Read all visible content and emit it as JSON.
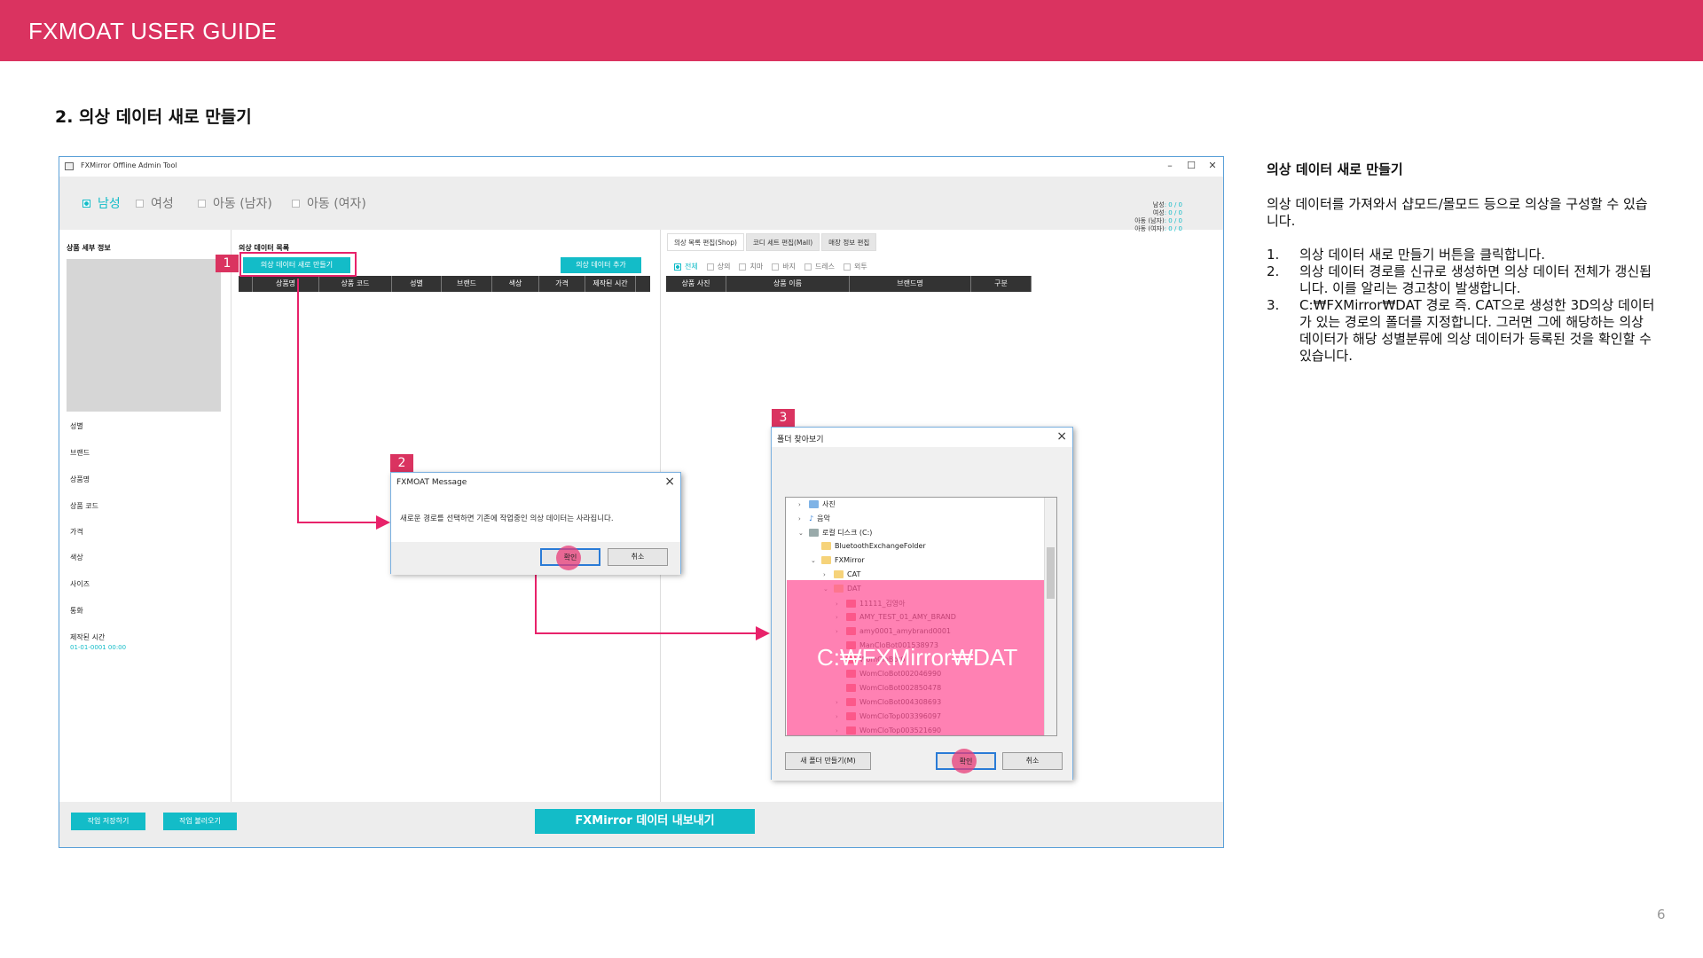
{
  "header": {
    "title": "FXMOAT USER GUIDE"
  },
  "section_title": "2. 의상 데이터 새로 만들기",
  "page_number": "6",
  "description": {
    "heading": "의상 데이터 새로 만들기",
    "intro": "의상 데이터를 가져와서 샵모드/몰모드 등으로 의상을 구성할 수 있습니다.",
    "steps": [
      {
        "num": "1.",
        "text": "의상 데이터 새로 만들기 버튼을 클릭합니다."
      },
      {
        "num": "2.",
        "text": "의상 데이터 경로를 신규로 생성하면 의상 데이터 전체가 갱신됩니다. 이를 알리는 경고창이 발생합니다."
      },
      {
        "num": "3.",
        "text": "C:₩FXMirror₩DAT 경로 즉. CAT으로 생성한 3D의상 데이터가 있는 경로의 폴더를 지정합니다. 그러면 그에 해당하는 의상 데이터가 해당 성별분류에 의상 데이터가 등록된 것을 확인할 수 있습니다."
      }
    ]
  },
  "app": {
    "window_title": "FXMirror Offline Admin Tool",
    "controls": {
      "minimize": "–",
      "maximize": "☐",
      "close": "✕"
    },
    "gender_options": [
      {
        "label": "남성",
        "selected": true
      },
      {
        "label": "여성",
        "selected": false
      },
      {
        "label": "아동 (남자)",
        "selected": false
      },
      {
        "label": "아동 (여자)",
        "selected": false
      }
    ],
    "counts": [
      {
        "label": "남성",
        "value": ": 0 / 0"
      },
      {
        "label": "여성",
        "value": ": 0 / 0"
      },
      {
        "label": "아동 (남자)",
        "value": ": 0 / 0"
      },
      {
        "label": "아동 (여자)",
        "value": ": 0 / 0"
      }
    ],
    "left_panel": {
      "heading": "상품 세부 정보",
      "fields": [
        "성별",
        "브랜드",
        "상품명",
        "상품 코드",
        "가격",
        "색상",
        "사이즈",
        "통화",
        "제작된 시간"
      ],
      "created_time_value": "01-01-0001 00:00"
    },
    "middle_panel": {
      "heading": "의상 데이터 목록",
      "new_button": "의상 데이터 새로 만들기",
      "add_button": "의상 데이터 추가",
      "columns": [
        "",
        "상품명",
        "상품 코드",
        "성별",
        "브랜드",
        "색상",
        "가격",
        "제작된 시간"
      ]
    },
    "right_panel": {
      "tabs": [
        "의상 목록 편집(Shop)",
        "코디 세트 편집(Mall)",
        "매장 정보 편집"
      ],
      "filters": [
        {
          "label": "전체",
          "selected": true
        },
        {
          "label": "상의",
          "selected": false
        },
        {
          "label": "치마",
          "selected": false
        },
        {
          "label": "바지",
          "selected": false
        },
        {
          "label": "드레스",
          "selected": false
        },
        {
          "label": "외투",
          "selected": false
        }
      ],
      "columns": [
        "상품 사진",
        "상품 이름",
        "브랜드명",
        "구분"
      ]
    },
    "bottom": {
      "save_button": "작업 저장하기",
      "load_button": "작업 불러오기",
      "export_button": "FXMirror 데이터 내보내기"
    }
  },
  "message_dialog": {
    "title": "FXMOAT Message",
    "message": "새로운 경로를 선택하면 기존에 작업중인 의상 데이터는 사라집니다.",
    "ok": "확인",
    "cancel": "취소"
  },
  "folder_dialog": {
    "title": "폴더 찾아보기",
    "tree": [
      {
        "label": "사진",
        "indent": 0,
        "arrow": ">",
        "icon": "pictures"
      },
      {
        "label": "음악",
        "indent": 0,
        "arrow": ">",
        "icon": "music"
      },
      {
        "label": "로컬 디스크 (C:)",
        "indent": 0,
        "arrow": "v",
        "icon": "drive"
      },
      {
        "label": "BluetoothExchangeFolder",
        "indent": 1,
        "arrow": "",
        "icon": "folder"
      },
      {
        "label": "FXMirror",
        "indent": 1,
        "arrow": "v",
        "icon": "folder"
      },
      {
        "label": "CAT",
        "indent": 2,
        "arrow": ">",
        "icon": "folder"
      },
      {
        "label": "DAT",
        "indent": 2,
        "arrow": "v",
        "icon": "folder"
      },
      {
        "label": "11111_김영아",
        "indent": 3,
        "arrow": ">",
        "icon": "folder"
      },
      {
        "label": "AMY_TEST_01_AMY_BRAND",
        "indent": 3,
        "arrow": ">",
        "icon": "folder"
      },
      {
        "label": "amy0001_amybrand0001",
        "indent": 3,
        "arrow": ">",
        "icon": "folder"
      },
      {
        "label": "ManCloBot001538973",
        "indent": 3,
        "arrow": "",
        "icon": "folder"
      },
      {
        "label": "WomCloBot0",
        "indent": 3,
        "arrow": "",
        "icon": "folder"
      },
      {
        "label": "WomCloBot002046990",
        "indent": 3,
        "arrow": "",
        "icon": "folder"
      },
      {
        "label": "WomCloBot002850478",
        "indent": 3,
        "arrow": "",
        "icon": "folder"
      },
      {
        "label": "WomCloBot004308693",
        "indent": 3,
        "arrow": ">",
        "icon": "folder"
      },
      {
        "label": "WomCloTop003396097",
        "indent": 3,
        "arrow": ">",
        "icon": "folder"
      },
      {
        "label": "WomCloTop003521690",
        "indent": 3,
        "arrow": ">",
        "icon": "folder"
      }
    ],
    "path_overlay": "C:₩FXMirror₩DAT",
    "new_folder": "새 폴더 만들기(M)",
    "ok": "확인",
    "cancel": "취소"
  },
  "steps_badges": [
    "1",
    "2",
    "3"
  ],
  "colors": {
    "header": "#DA3360",
    "accent": "#13BCC8",
    "annotation": "#E8226A"
  }
}
